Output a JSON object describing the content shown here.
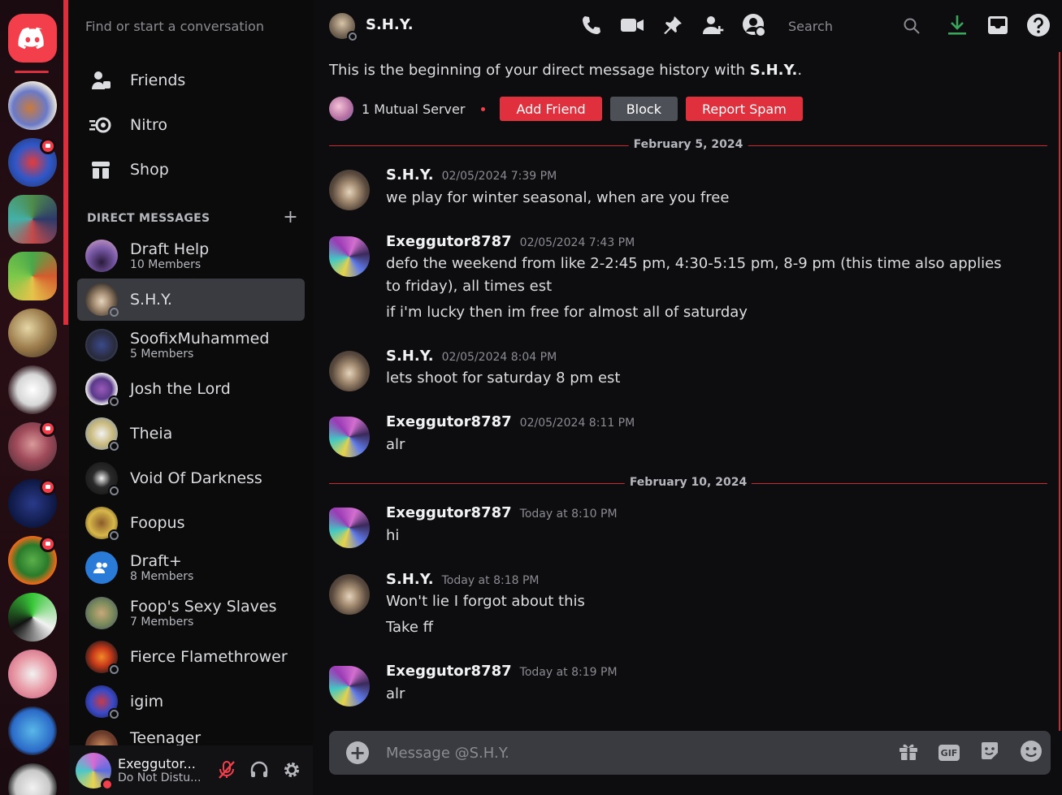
{
  "search": {
    "placeholder": "Find or start a conversation"
  },
  "nav": [
    {
      "label": "Friends",
      "icon": "friends-icon"
    },
    {
      "label": "Nitro",
      "icon": "nitro-icon"
    },
    {
      "label": "Shop",
      "icon": "shop-icon"
    }
  ],
  "dm_header": {
    "title": "DIRECT MESSAGES",
    "add": "+"
  },
  "dms": [
    {
      "name": "Draft Help",
      "sub": "10 Members"
    },
    {
      "name": "S.H.Y.",
      "sub": ""
    },
    {
      "name": "SoofixMuhammed",
      "sub": "5 Members"
    },
    {
      "name": "Josh the Lord",
      "sub": ""
    },
    {
      "name": "Theia",
      "sub": ""
    },
    {
      "name": "Void Of Darkness",
      "sub": ""
    },
    {
      "name": "Foopus",
      "sub": ""
    },
    {
      "name": "Draft+",
      "sub": "8 Members"
    },
    {
      "name": "Foop's Sexy Slaves",
      "sub": "7 Members"
    },
    {
      "name": "Fierce Flamethrower",
      "sub": ""
    },
    {
      "name": "igim",
      "sub": ""
    },
    {
      "name": "Teenager",
      "sub": ""
    }
  ],
  "user": {
    "name": "Exeggutor...",
    "status": "Do Not Distu..."
  },
  "topbar": {
    "name": "S.H.Y.",
    "search_placeholder": "Search"
  },
  "intro": {
    "text": "This is the beginning of your direct message history with ",
    "name": "S.H.Y.",
    "suffix": ".",
    "mutual": "1 Mutual Server",
    "add_friend": "Add Friend",
    "block": "Block",
    "report": "Report Spam"
  },
  "dividers": [
    "February 5, 2024",
    "February 10, 2024"
  ],
  "messages": [
    {
      "author": "S.H.Y.",
      "time": "02/05/2024 7:39 PM",
      "lines": [
        "we play for winter seasonal, when are you free"
      ]
    },
    {
      "author": "Exeggutor8787",
      "time": "02/05/2024 7:43 PM",
      "lines": [
        "defo the weekend from like 2-2:45 pm, 4:30-5:15 pm, 8-9 pm (this time also applies",
        "to friday), all times est",
        "if i'm lucky then im free for almost all of saturday"
      ]
    },
    {
      "author": "S.H.Y.",
      "time": "02/05/2024 8:04 PM",
      "lines": [
        "lets shoot for saturday 8 pm est"
      ]
    },
    {
      "author": "Exeggutor8787",
      "time": "02/05/2024 8:11 PM",
      "lines": [
        "alr"
      ]
    },
    {
      "author": "Exeggutor8787",
      "time": "Today at 8:10 PM",
      "lines": [
        "hi"
      ]
    },
    {
      "author": "S.H.Y.",
      "time": "Today at 8:18 PM",
      "lines": [
        "Won't lie I forgot about this",
        "Take ff"
      ]
    },
    {
      "author": "Exeggutor8787",
      "time": "Today at 8:19 PM",
      "lines": [
        "alr"
      ]
    }
  ],
  "composer": {
    "placeholder": "Message @S.H.Y.",
    "gif": "GIF"
  },
  "colors": {
    "accent": "#f23f4b",
    "divider": "#c42b37",
    "background": "#0d0d0f"
  }
}
